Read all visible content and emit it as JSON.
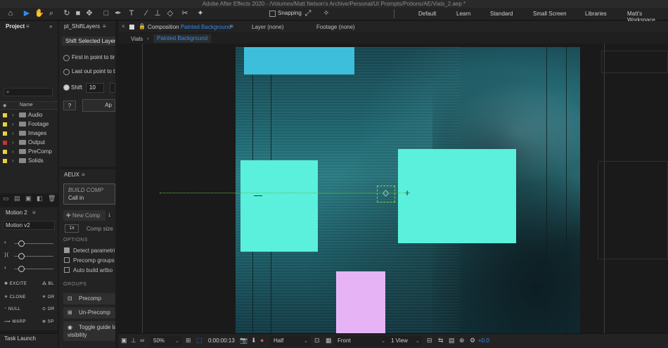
{
  "window": {
    "title": "Adobe After Effects 2020 - /Volumes/Matt Nelson's Archive/Personal/UI Prompts/Potions/AE/Vials_2.aep *"
  },
  "toolbar": {
    "snapping_label": "Snapping",
    "workspaces": [
      "Default",
      "Learn",
      "Standard",
      "Small Screen",
      "Libraries",
      "Matt's Workspace"
    ]
  },
  "project": {
    "tab_label": "Project",
    "search_placeholder": "",
    "column_name": "Name",
    "items": [
      {
        "label": "Audio",
        "color": "#e3d33b"
      },
      {
        "label": "Footage",
        "color": "#e3d33b"
      },
      {
        "label": "Images",
        "color": "#e3d33b"
      },
      {
        "label": "Output",
        "color": "#c8332f"
      },
      {
        "label": "PreComp",
        "color": "#e3d33b"
      },
      {
        "label": "Solids",
        "color": "#e3d33b"
      }
    ]
  },
  "motion": {
    "tab_label": "Motion 2",
    "version_label": "Motion v2",
    "buttons": [
      "EXCITE",
      "BL",
      "CLONE",
      "OR",
      "NULL",
      "OR",
      "WARP",
      "SP"
    ]
  },
  "task_launch": {
    "label": "Task Launch"
  },
  "shift_layers": {
    "tab_label": "pt_ShiftLayers",
    "header": "Shift Selected Layers",
    "option_first": "First in point to tir",
    "option_last": "Last out point to ti",
    "option_shift": "Shift",
    "shift_value": "10",
    "help_label": "?",
    "apply_label": "Ap"
  },
  "aeux": {
    "tab_label": "AEUX",
    "build_comp_label": "BUILD COMP",
    "call_in_label": "Call in",
    "new_comp_label": "New Comp",
    "scale_label": "1x",
    "comp_size_label": "Comp size",
    "options_header": "OPTIONS",
    "opt_detect": "Detect parametri",
    "opt_precomp_groups": "Precomp groups",
    "opt_auto_build": "Auto build artbo",
    "groups_header": "GROUPS",
    "precomp_label": "Precomp",
    "unprecomp_label": "Un-Precomp",
    "toggle_guide_label": "Toggle guide la",
    "visibility_label": "visibility"
  },
  "composition": {
    "tab_prefix": "Composition",
    "tab_name": "Painted Background",
    "layer_tab": "Layer (none)",
    "footage_tab": "Footage (none)",
    "breadcrumb_parent": "Vials",
    "breadcrumb_current": "Painted Background",
    "accent": "#2d8ceb",
    "rect_color_cyan": "#5af0dc",
    "rect_color_blue": "#3dbfdc",
    "rect_color_lilac": "#e6b4f5"
  },
  "viewer_footer": {
    "zoom": "50%",
    "timecode": "0:00:00:13",
    "resolution": "Half",
    "view": "Front",
    "views_count": "1 View",
    "exposure": "+0.0"
  }
}
